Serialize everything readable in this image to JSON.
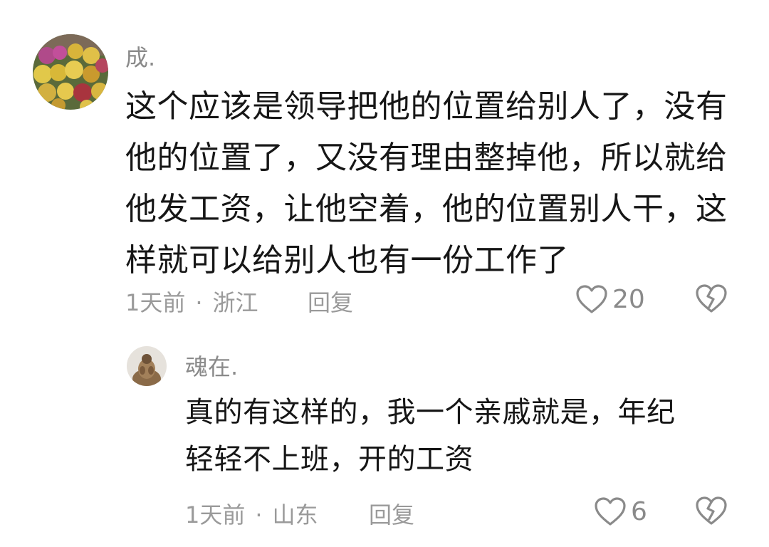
{
  "comments": [
    {
      "username": "成.",
      "text_lines": [
        "这个应该是领导把他的位置给别人了，没有",
        "他的位置了，又没有理由整掉他，所以就给",
        "他发工资，让他空着，他的位置别人干，这",
        "样就可以给别人也有一份工作了"
      ],
      "time": "1天前",
      "separator": "·",
      "location": "浙江",
      "reply_label": "回复",
      "like_count": "20",
      "avatar_icon": "chrysanthemum-flowers-avatar"
    },
    {
      "username": "魂在.",
      "text_lines": [
        "真的有这样的，我一个亲戚就是，年纪",
        "轻轻不上班，开的工资"
      ],
      "time": "1天前",
      "separator": "·",
      "location": "山东",
      "reply_label": "回复",
      "like_count": "6",
      "avatar_icon": "statue-avatar"
    }
  ],
  "icons": {
    "like": "heart-outline-icon",
    "dislike": "broken-heart-icon"
  },
  "colors": {
    "text": "#161616",
    "meta": "#9a9a9a",
    "icon": "#8a8a8a"
  }
}
